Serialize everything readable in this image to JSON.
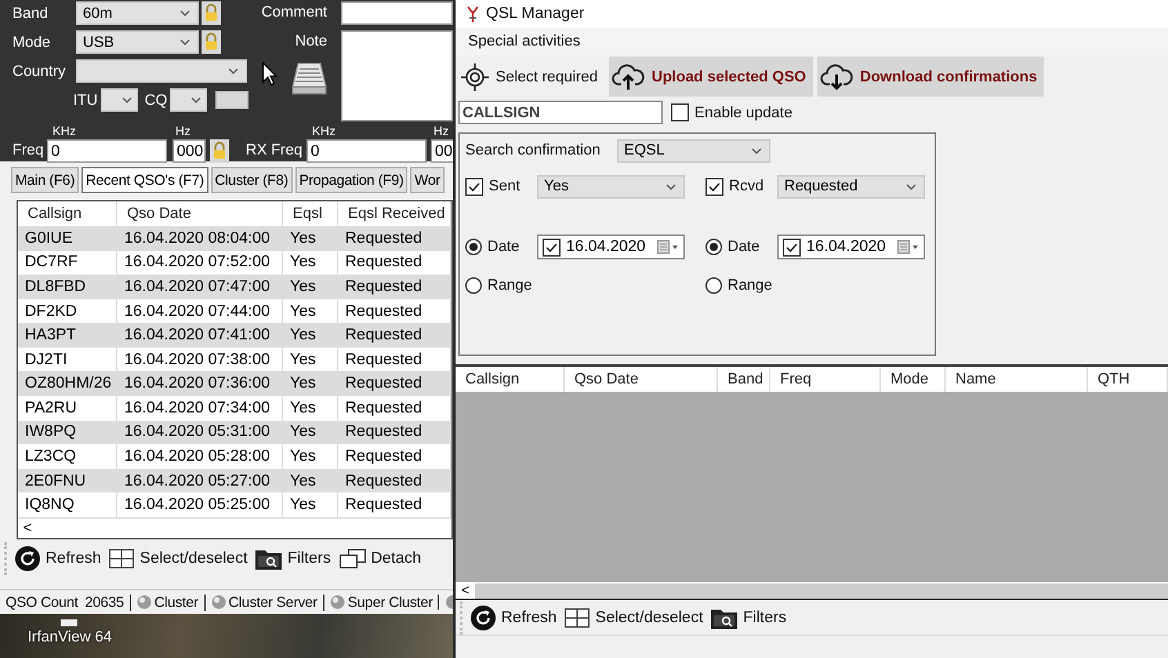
{
  "logbook": {
    "fields": [
      {
        "label": "Band",
        "value": "60m"
      },
      {
        "label": "Mode",
        "value": "USB"
      }
    ],
    "country": {
      "label": "Country"
    },
    "itu": {
      "label": "ITU"
    },
    "cq": {
      "label": "CQ"
    },
    "comment": {
      "label": "Comment"
    },
    "note": {
      "label": "Note"
    },
    "freq": {
      "label": "Freq",
      "khz_unit": "KHz",
      "khz_value": "0",
      "hz_unit": "Hz",
      "hz_value": "000"
    },
    "rx_freq": {
      "label": "RX Freq",
      "khz_unit": "KHz",
      "khz_value": "0",
      "hz_unit": "Hz",
      "hz_value": "00"
    },
    "tabs": [
      {
        "label": "Main (F6)",
        "selected": false
      },
      {
        "label": "Recent QSO's (F7)",
        "selected": true
      },
      {
        "label": "Cluster (F8)",
        "selected": false
      },
      {
        "label": "Propagation (F9)",
        "selected": false
      },
      {
        "label": "Wor",
        "selected": false
      }
    ],
    "table": {
      "columns": [
        "Callsign",
        "Qso Date",
        "Eqsl",
        "Eqsl Received"
      ],
      "rows": [
        [
          "G0IUE",
          "16.04.2020 08:04:00",
          "Yes",
          "Requested"
        ],
        [
          "DC7RF",
          "16.04.2020 07:52:00",
          "Yes",
          "Requested"
        ],
        [
          "DL8FBD",
          "16.04.2020 07:47:00",
          "Yes",
          "Requested"
        ],
        [
          "DF2KD",
          "16.04.2020 07:44:00",
          "Yes",
          "Requested"
        ],
        [
          "HA3PT",
          "16.04.2020 07:41:00",
          "Yes",
          "Requested"
        ],
        [
          "DJ2TI",
          "16.04.2020 07:38:00",
          "Yes",
          "Requested"
        ],
        [
          "OZ80HM/26",
          "16.04.2020 07:36:00",
          "Yes",
          "Requested"
        ],
        [
          "PA2RU",
          "16.04.2020 07:34:00",
          "Yes",
          "Requested"
        ],
        [
          "IW8PQ",
          "16.04.2020 05:31:00",
          "Yes",
          "Requested"
        ],
        [
          "LZ3CQ",
          "16.04.2020 05:28:00",
          "Yes",
          "Requested"
        ],
        [
          "2E0FNU",
          "16.04.2020 05:27:00",
          "Yes",
          "Requested"
        ],
        [
          "IQ8NQ",
          "16.04.2020 05:25:00",
          "Yes",
          "Requested"
        ]
      ],
      "scroll_left": "<"
    },
    "toolbar": [
      {
        "kind": "refresh",
        "label": "Refresh"
      },
      {
        "kind": "grid",
        "label": "Select/deselect"
      },
      {
        "kind": "filter",
        "label": "Filters"
      },
      {
        "kind": "detach",
        "label": "Detach"
      }
    ],
    "status_bar": {
      "qso_count_label": "QSO Count",
      "qso_count": "20635",
      "indicators": [
        "Cluster",
        "Cluster Server",
        "Super Cluster"
      ]
    },
    "desktop_icons": [
      {
        "label": "IrfanView 64"
      }
    ]
  },
  "qsl_manager": {
    "title": "QSL Manager",
    "menu": [
      "Special activities"
    ],
    "toolbar": [
      {
        "kind": "target",
        "label": "Select required",
        "emphasized": false
      },
      {
        "kind": "upload",
        "label": "Upload selected QSO",
        "emphasized": true
      },
      {
        "kind": "download",
        "label": "Download confirmations",
        "emphasized": true
      }
    ],
    "callsign": {
      "value": "CALLSIGN"
    },
    "enable_update": {
      "label": "Enable update",
      "checked": false
    },
    "search": {
      "label": "Search confirmation",
      "value": "EQSL"
    },
    "filters": [
      {
        "label": "Sent",
        "checked": true,
        "value": "Yes",
        "date_options": [
          {
            "label": "Date",
            "selected": true
          },
          {
            "label": "Range",
            "selected": false
          }
        ],
        "date_checked": true,
        "date": "16.04.2020"
      },
      {
        "label": "Rcvd",
        "checked": true,
        "value": "Requested",
        "date_options": [
          {
            "label": "Date",
            "selected": true
          },
          {
            "label": "Range",
            "selected": false
          }
        ],
        "date_checked": true,
        "date": "16.04.2020"
      }
    ],
    "table": {
      "columns": [
        "Callsign",
        "Qso Date",
        "Band",
        "Freq",
        "Mode",
        "Name",
        "QTH"
      ],
      "scroll_left": "<"
    },
    "bottom_toolbar": [
      {
        "kind": "refresh",
        "label": "Refresh"
      },
      {
        "kind": "grid",
        "label": "Select/deselect"
      },
      {
        "kind": "filter",
        "label": "Filters"
      }
    ]
  }
}
